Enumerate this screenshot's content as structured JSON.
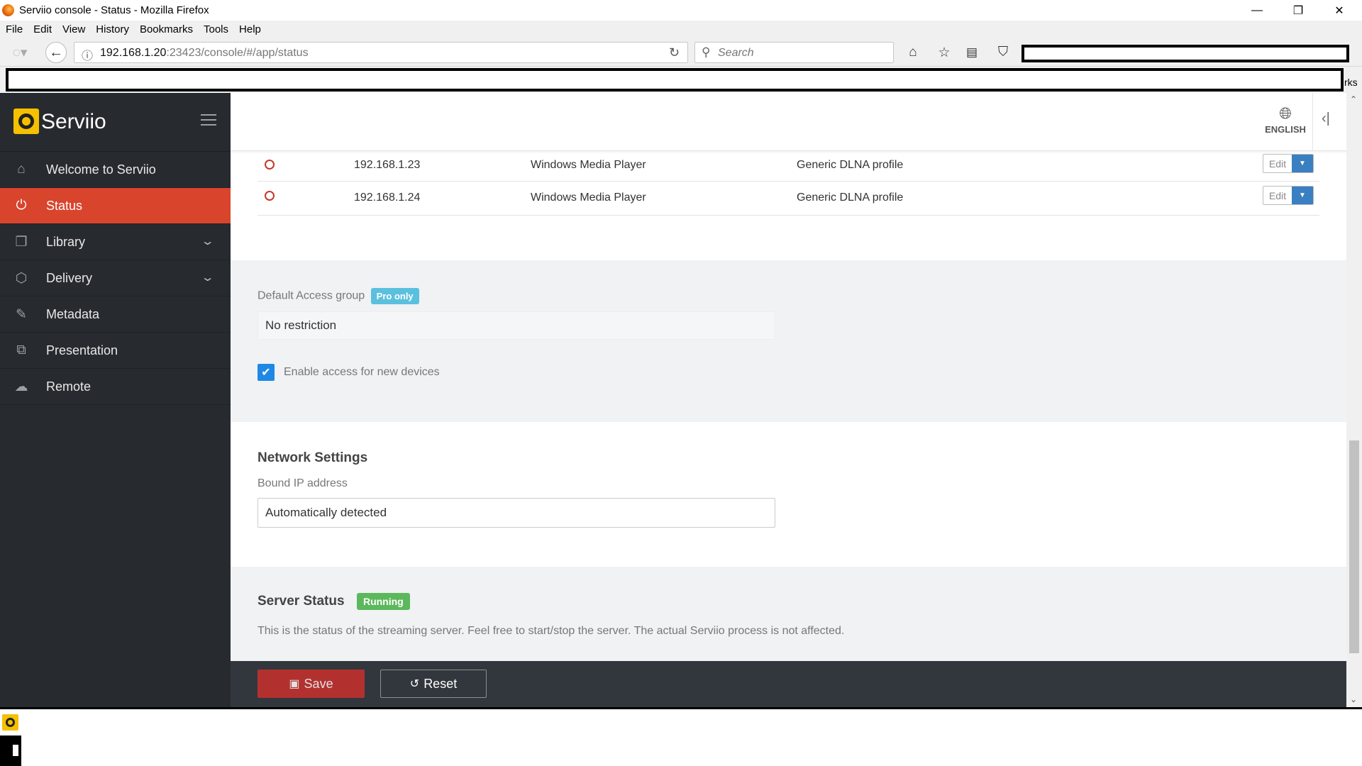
{
  "window": {
    "title": "Serviio console - Status - Mozilla Firefox",
    "minimize": "—",
    "restore": "❐",
    "close": "✕"
  },
  "menubar": {
    "items": [
      "File",
      "Edit",
      "View",
      "History",
      "Bookmarks",
      "Tools",
      "Help"
    ]
  },
  "navbar": {
    "url_host": "192.168.1.20",
    "url_rest": ":23423/console/#/app/status",
    "search_placeholder": "Search"
  },
  "bookmarks_bar": {
    "visible_fragment": "rks"
  },
  "sidebar": {
    "brand": "Serviio",
    "items": [
      {
        "label": "Welcome to Serviio",
        "icon": "home-icon",
        "glyph": "⌂"
      },
      {
        "label": "Status",
        "icon": "plug-icon",
        "glyph": "⏻"
      },
      {
        "label": "Library",
        "icon": "library-icon",
        "glyph": "❐"
      },
      {
        "label": "Delivery",
        "icon": "box-icon",
        "glyph": "⬡"
      },
      {
        "label": "Metadata",
        "icon": "edit-icon",
        "glyph": "✎"
      },
      {
        "label": "Presentation",
        "icon": "presentation-icon",
        "glyph": "⧉"
      },
      {
        "label": "Remote",
        "icon": "cloud-icon",
        "glyph": "☁"
      }
    ],
    "active": "Status"
  },
  "topbar": {
    "language": "ENGLISH",
    "collapse_glyph": "‹|"
  },
  "devices": [
    {
      "ip": "192.168.1.23",
      "player": "Windows Media Player",
      "profile": "Generic DLNA profile",
      "action": "Edit"
    },
    {
      "ip": "192.168.1.24",
      "player": "Windows Media Player",
      "profile": "Generic DLNA profile",
      "action": "Edit"
    }
  ],
  "access": {
    "label": "Default Access group",
    "badge": "Pro only",
    "value": "No restriction",
    "checkbox_label": "Enable access for new devices",
    "checked": true
  },
  "network": {
    "heading": "Network Settings",
    "label": "Bound IP address",
    "value": "Automatically detected"
  },
  "server": {
    "heading": "Server Status",
    "badge": "Running",
    "description": "This is the status of the streaming server. Feel free to start/stop the server. The actual Serviio process is not affected."
  },
  "footer": {
    "save": "Save",
    "reset": "Reset"
  },
  "colors": {
    "accent": "#d9442d",
    "sidebar": "#272b30",
    "pro_badge": "#5bc0de",
    "running_badge": "#5cb85c",
    "checkbox": "#1e88e5",
    "brand_logo": "#f5c000"
  }
}
